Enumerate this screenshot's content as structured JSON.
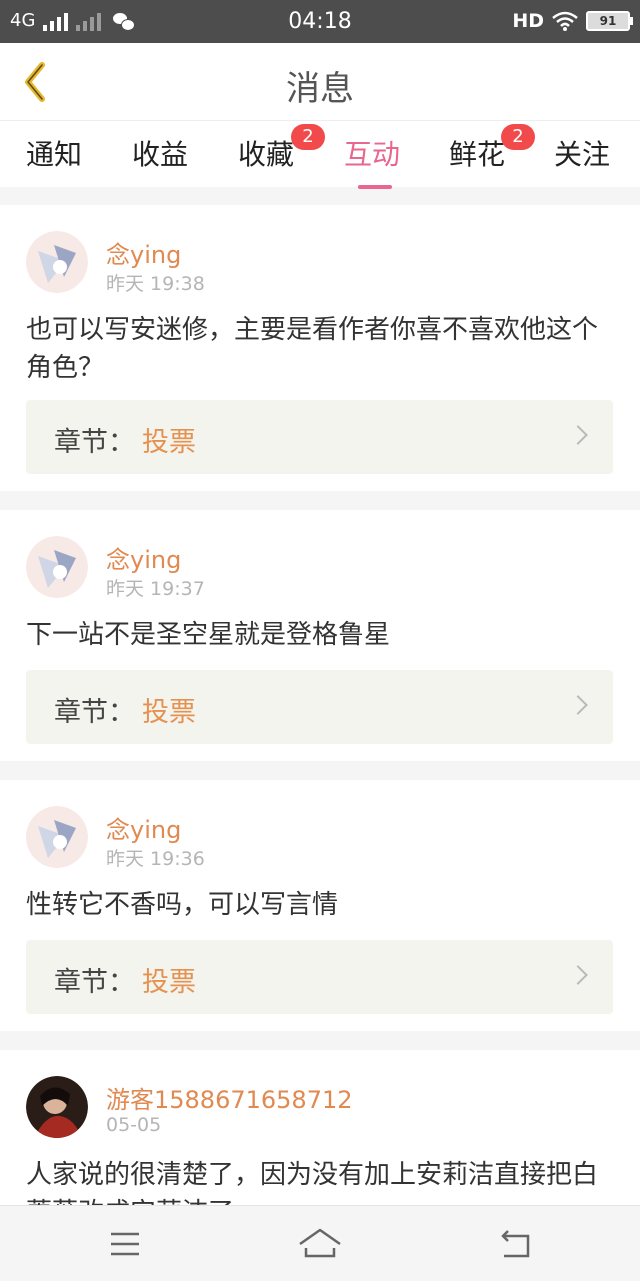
{
  "status_bar": {
    "network": "4G",
    "time": "04:18",
    "hd": "HD",
    "battery": "91"
  },
  "header": {
    "title": "消息",
    "back_icon": "chevron-left-icon"
  },
  "tabs": [
    {
      "label": "通知",
      "badge": null,
      "active": false
    },
    {
      "label": "收益",
      "badge": null,
      "active": false
    },
    {
      "label": "收藏",
      "badge": "2",
      "active": false
    },
    {
      "label": "互动",
      "badge": null,
      "active": true
    },
    {
      "label": "鲜花",
      "badge": "2",
      "active": false
    },
    {
      "label": "关注",
      "badge": null,
      "active": false
    }
  ],
  "messages": [
    {
      "user": "念ying",
      "time": "昨天 19:38",
      "text": "也可以写安迷修，主要是看作者你喜不喜欢他这个角色？",
      "chapter_label": "章节：",
      "chapter_name": "投票"
    },
    {
      "user": "念ying",
      "time": "昨天 19:37",
      "text": "下一站不是圣空星就是登格鲁星",
      "chapter_label": "章节：",
      "chapter_name": "投票"
    },
    {
      "user": "念ying",
      "time": "昨天 19:36",
      "text": "性转它不香吗，可以写言情",
      "chapter_label": "章节：",
      "chapter_name": "投票"
    },
    {
      "user": "游客1588671658712",
      "time": "05-05",
      "text": "人家说的很清楚了，因为没有加上安莉洁直接把白蔷薇改成安莉洁了"
    }
  ],
  "colors": {
    "accent": "#e8668f",
    "username": "#e08a52",
    "link": "#e59251",
    "badge": "#f24a4a"
  }
}
